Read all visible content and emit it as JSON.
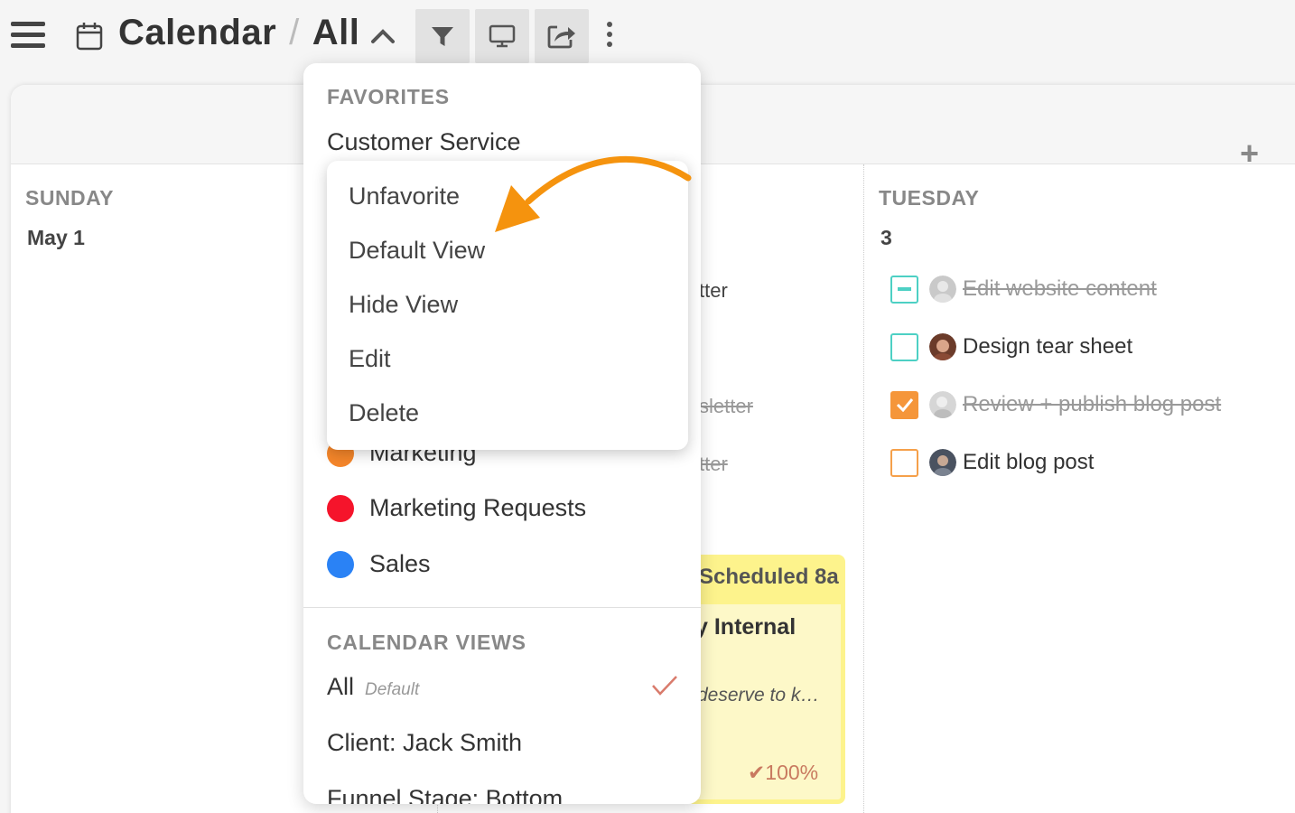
{
  "header": {
    "app_title": "Calendar",
    "separator": "/",
    "view_name": "All"
  },
  "days": {
    "sunday": {
      "name": "SUNDAY",
      "date": "May 1"
    },
    "tuesday": {
      "name": "TUESDAY",
      "date": "3"
    }
  },
  "background_partial": {
    "item1": "tter",
    "item2": "sletter",
    "item3": "tter",
    "event_scheduled": "Scheduled 8a",
    "event_title": "y Internal",
    "event_desc": "deserve to k…",
    "event_progress": "✔100%"
  },
  "tasks": [
    {
      "label": "Edit website content",
      "state": "partial",
      "done": true
    },
    {
      "label": "Design tear sheet",
      "state": "unchecked",
      "done": false
    },
    {
      "label": "Review + publish blog post",
      "state": "checked",
      "done": true
    },
    {
      "label": "Edit blog post",
      "state": "unchecked",
      "done": false
    }
  ],
  "menu": {
    "favorites_title": "FAVORITES",
    "favorites": [
      "Customer Service"
    ],
    "labels": [
      {
        "name": "Marketing",
        "color": "#f5862a"
      },
      {
        "name": "Marketing Requests",
        "color": "#f5142b"
      },
      {
        "name": "Sales",
        "color": "#2a82f5"
      }
    ],
    "views_title": "CALENDAR VIEWS",
    "views": [
      {
        "name": "All",
        "tag": "Default",
        "selected": true
      },
      {
        "name": "Client: Jack Smith"
      },
      {
        "name": "Funnel Stage: Bottom"
      }
    ]
  },
  "context_menu": {
    "items": [
      "Unfavorite",
      "Default View",
      "Hide View",
      "Edit",
      "Delete"
    ]
  },
  "colors": {
    "accent_orange": "#f5930e",
    "teal": "#4dd0c4",
    "event_yellow": "#fdf38c"
  },
  "icons": [
    "menu-icon",
    "calendar-icon",
    "chevron-up-icon",
    "filter-icon",
    "monitor-icon",
    "share-icon",
    "more-vertical-icon",
    "plus-icon",
    "checkmark-icon"
  ]
}
